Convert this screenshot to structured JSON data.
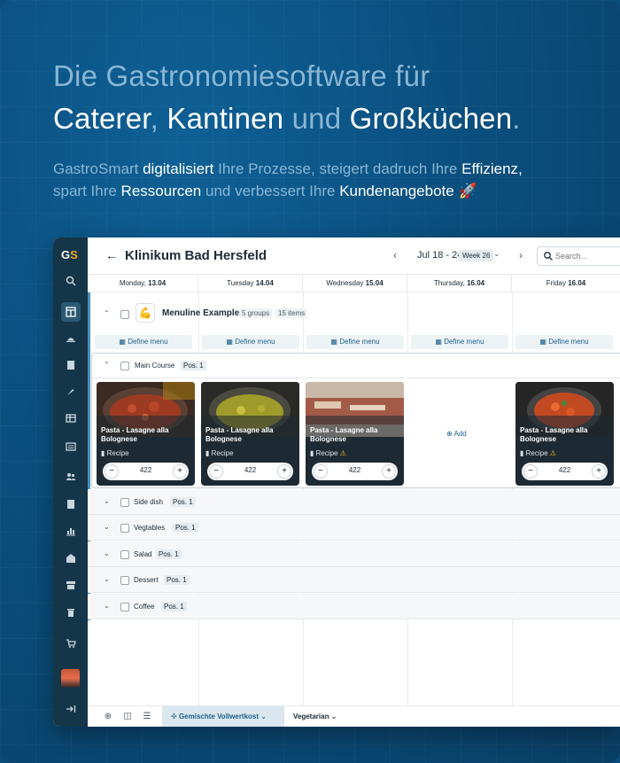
{
  "hero": {
    "line1": "Die Gastronomiesoftware für",
    "line2_a": "Caterer",
    "line2_b": ", ",
    "line2_c": "Kantinen",
    "line2_d": " und ",
    "line2_e": "Großküchen",
    "line2_f": ".",
    "sub_a": "GastroSmart ",
    "sub_b": "digitalisiert",
    "sub_c": " Ihre Prozesse, steigert dadruch Ihre ",
    "sub_d": "Effizienz",
    "sub_e": ",",
    "sub_f": "spart Ihre ",
    "sub_g": "Ressourcen",
    "sub_h": " und verbessert Ihre ",
    "sub_i": "Kundenangebote",
    "sub_j": " 🚀"
  },
  "app": {
    "logo_g": "G",
    "logo_s": "S",
    "page_title": "Klinikum Bad Hersfeld",
    "date_range": "Jul 18 - 24",
    "week_badge": "Week 26",
    "search_placeholder": "Search...",
    "days": [
      {
        "name": "Monday,",
        "date": "13.04"
      },
      {
        "name": "Tuesday",
        "date": "14.04"
      },
      {
        "name": "Wednesday",
        "date": "15.04"
      },
      {
        "name": "Thursday,",
        "date": "16.04"
      },
      {
        "name": "Friday",
        "date": "16.04"
      }
    ],
    "menuline": {
      "icon": "💪",
      "title": "Menuline Example",
      "groups": "5 groups",
      "items": "15 items",
      "define_label": "Define menu"
    },
    "course": {
      "label": "Main Course",
      "pos": "Pos. 1",
      "dishes": [
        {
          "name": "Pasta - Lasagne alla Bolognese",
          "recipe": "Recipe",
          "qty": "422",
          "warning": false
        },
        {
          "name": "Pasta - Lasagne alla Bolognese",
          "recipe": "Recipe",
          "qty": "422",
          "warning": false
        },
        {
          "name": "Pasta - Lasagne alla Bolognese",
          "recipe": "Recipe",
          "qty": "422",
          "warning": true
        },
        {
          "name": "Pasta - Lasagne alla Bolognese",
          "recipe": "Recipe",
          "qty": "422",
          "warning": true
        }
      ],
      "add_label": "Add"
    },
    "groups": [
      {
        "label": "Side dish",
        "pos": "Pos. 1"
      },
      {
        "label": "Vegtables",
        "pos": "Pos. 1"
      },
      {
        "label": "Salad",
        "pos": "Pos. 1"
      },
      {
        "label": "Dessert",
        "pos": "Pos. 1"
      },
      {
        "label": "Coffee",
        "pos": "Pos. 1"
      }
    ],
    "bottom_tabs": {
      "active": "Gemischte Vollwertkost",
      "other": "Vegetarian"
    },
    "colors": {
      "accent": "#1c5f8c",
      "sidebar": "#143648",
      "warning": "#f5c518",
      "brand_orange": "#f5a623"
    }
  }
}
